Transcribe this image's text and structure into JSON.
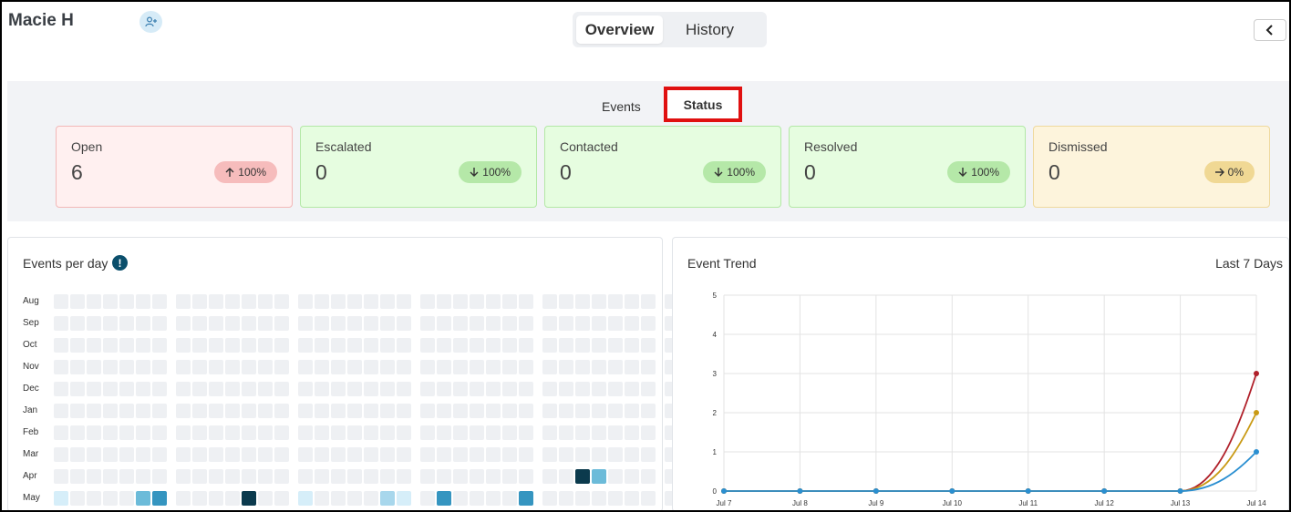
{
  "header": {
    "user_name": "Macie H",
    "tabs": [
      {
        "label": "Overview",
        "active": true
      },
      {
        "label": "History",
        "active": false
      }
    ]
  },
  "status_section": {
    "subtabs": [
      {
        "label": "Events",
        "active": false
      },
      {
        "label": "Status",
        "active": true
      }
    ],
    "cards": [
      {
        "label": "Open",
        "value": "6",
        "change": "100%",
        "direction": "up",
        "bg": "#fff0f0",
        "border": "#f2b8b8",
        "pill_bg": "#f6bcbc"
      },
      {
        "label": "Escalated",
        "value": "0",
        "change": "100%",
        "direction": "down",
        "bg": "#e6fde0",
        "border": "#b3e8a6",
        "pill_bg": "#b5e8a8"
      },
      {
        "label": "Contacted",
        "value": "0",
        "change": "100%",
        "direction": "down",
        "bg": "#e6fde0",
        "border": "#b3e8a6",
        "pill_bg": "#b5e8a8"
      },
      {
        "label": "Resolved",
        "value": "0",
        "change": "100%",
        "direction": "down",
        "bg": "#e6fde0",
        "border": "#b3e8a6",
        "pill_bg": "#b5e8a8"
      },
      {
        "label": "Dismissed",
        "value": "0",
        "change": "0%",
        "direction": "right",
        "bg": "#fdf4dc",
        "border": "#efd99e",
        "pill_bg": "#f0d894"
      }
    ]
  },
  "events_per_day": {
    "title": "Events per day",
    "months": [
      "Aug",
      "Sep",
      "Oct",
      "Nov",
      "Dec",
      "Jan",
      "Feb",
      "Mar",
      "Apr",
      "May"
    ],
    "colors": {
      "empty": "#eef0f3",
      "level1": "#d6eef9",
      "level2": "#a8d7ec",
      "level3": "#6cbbd9",
      "level4": "#3595c0",
      "level5": "#0b3a4d"
    },
    "highlights": [
      {
        "row": 8,
        "col": 30,
        "level": 5
      },
      {
        "row": 8,
        "col": 31,
        "level": 3
      },
      {
        "row": 9,
        "col": 0,
        "level": 1
      },
      {
        "row": 9,
        "col": 5,
        "level": 3
      },
      {
        "row": 9,
        "col": 6,
        "level": 4
      },
      {
        "row": 9,
        "col": 11,
        "level": 5
      },
      {
        "row": 9,
        "col": 14,
        "level": 1
      },
      {
        "row": 9,
        "col": 19,
        "level": 2
      },
      {
        "row": 9,
        "col": 20,
        "level": 1
      },
      {
        "row": 9,
        "col": 22,
        "level": 4
      },
      {
        "row": 9,
        "col": 27,
        "level": 4
      }
    ]
  },
  "event_trend": {
    "title": "Event Trend",
    "range_label": "Last 7 Days"
  },
  "chart_data": {
    "type": "line",
    "title": "Event Trend",
    "x": [
      "Jul 7",
      "Jul 8",
      "Jul 9",
      "Jul 10",
      "Jul 11",
      "Jul 12",
      "Jul 13",
      "Jul 14"
    ],
    "ylim": [
      0,
      5
    ],
    "yticks": [
      0,
      1,
      2,
      3,
      4,
      5
    ],
    "grid": true,
    "series": [
      {
        "color": "#b0202a",
        "values": [
          0,
          0,
          0,
          0,
          0,
          0,
          0,
          3
        ]
      },
      {
        "color": "#c99a14",
        "values": [
          0,
          0,
          0,
          0,
          0,
          0,
          0,
          2
        ]
      },
      {
        "color": "#2a8fd1",
        "values": [
          0,
          0,
          0,
          0,
          0,
          0,
          0,
          1
        ]
      }
    ]
  }
}
